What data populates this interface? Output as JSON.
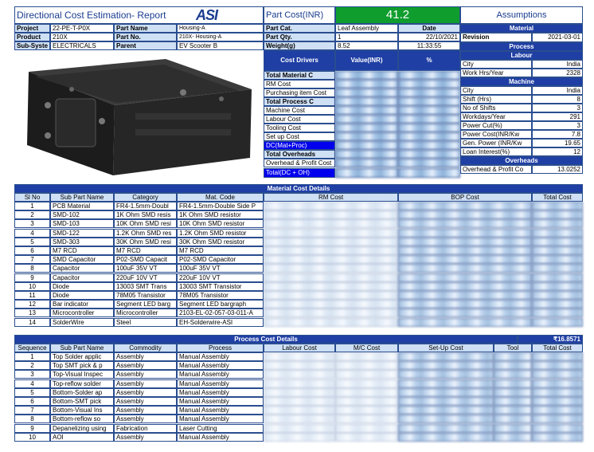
{
  "header": {
    "title": "Directional Cost Estimation- Report",
    "logo": "ASI",
    "part_cost_label": "Part Cost(INR)",
    "part_cost_value": "41.2",
    "assumptions_label": "Assumptions",
    "project_label": "Project",
    "project_value": "22-PE-T-P0X",
    "product_label": "Product",
    "product_value": "210X",
    "subsys_label": "Sub-Syste",
    "subsys_value": "ELECTRICALS",
    "part_name_label": "Part Name",
    "part_name_value": "Housing-A",
    "part_no_label": "Part No.",
    "part_no_value": "210X- Housing-A",
    "parent_label": "Parent",
    "parent_value": "EV Scooter B",
    "part_cat_label": "Part Cat.",
    "part_cat_value": "Leaf Assembly",
    "date_label": "Date",
    "date_value": "22/10/2021",
    "part_qty_label": "Part Qty.",
    "part_qty_value": "1",
    "weight_label": "Weight(g)",
    "weight_value": "8.52",
    "time_value": "11:33:55"
  },
  "drivers": {
    "col1": "Cost Drivers",
    "col2": "Value(INR)",
    "col3": "%",
    "rows": [
      "Total Material C",
      "RM Cost",
      "Purchasing item Cost",
      "Total Process C",
      "Machine Cost",
      "Labour Cost",
      "Tooling Cost",
      "Set up Cost",
      "DC(Mat+Proc)",
      "Total Overheads",
      "Overhead & Profit Cost",
      "Total(DC + OH)"
    ]
  },
  "assumptions": {
    "material_header": "Material",
    "revision_label": "Revision",
    "revision_value": "2021-03-01",
    "process_header": "Process",
    "labour_header": "Labour",
    "labour_rows": [
      [
        "City",
        "India"
      ],
      [
        "Work Hrs/Year",
        "2328"
      ]
    ],
    "machine_header": "Machine",
    "machine_rows": [
      [
        "City",
        "India"
      ],
      [
        "Shift (Hrs)",
        "8"
      ],
      [
        "No of Shifts",
        "3"
      ],
      [
        "Workdays/Year",
        "291"
      ],
      [
        "Power Cut(%)",
        "3"
      ],
      [
        "Power Cost(INR/Kw",
        "7.8"
      ],
      [
        "Gen. Power (INR/Kw",
        "19.65"
      ],
      [
        "Loan Interest(%)",
        "12"
      ]
    ],
    "overheads_header": "Overheads",
    "overhead_rows": [
      [
        "Overhead & Profit Co",
        "13.0252"
      ]
    ]
  },
  "material": {
    "title": "Material Cost Details",
    "headers": [
      "Sl No",
      "Sub Part Name",
      "Category",
      "Mat. Code",
      "RM Cost",
      "BOP Cost",
      "Total Cost"
    ],
    "rows": [
      [
        "1",
        "PCB Material",
        "FR4-1.5mm-Doubl",
        "FR4-1.5mm-Double Side P"
      ],
      [
        "2",
        "SMD-102",
        "1K Ohm SMD resis",
        "1K Ohm SMD resistor"
      ],
      [
        "3",
        "SMD-103",
        "10K Ohm SMD resi",
        "10K Ohm SMD resistor"
      ],
      [
        "4",
        "SMD-122",
        "1.2K Ohm SMD res",
        "1.2K Ohm SMD resistor"
      ],
      [
        "5",
        "SMD-303",
        "30K Ohm SMD resi",
        "30K Ohm SMD resistor"
      ],
      [
        "6",
        "M7 RCD",
        "M7 RCD",
        "M7 RCD"
      ],
      [
        "7",
        "SMD Capacitor",
        "P02-SMD Capacit",
        "P02-SMD Capacitor"
      ],
      [
        "8",
        "Capacitor",
        "100uF 35V VT",
        "100uF 35V VT"
      ],
      [
        "9",
        "Capacitor",
        "220uF 10V VT",
        "220uF 10V VT"
      ],
      [
        "10",
        "Diode",
        "13003 SMT Trans",
        "13003 SMT Transistor"
      ],
      [
        "11",
        "Diode",
        "78M05 Transistor",
        "78M05 Transistor"
      ],
      [
        "12",
        "Bar indicator",
        "Segment LED barg",
        "Segment LED bargraph"
      ],
      [
        "13",
        "Microcontroller",
        "Microcontroller",
        "2103-EL-02-057-03-011-A"
      ],
      [
        "14",
        "SolderWire",
        "Steel",
        "EH-Solderwire-ASI"
      ]
    ]
  },
  "process": {
    "title": "Process Cost Details",
    "total": "₹16.8571",
    "headers": [
      "Sequence",
      "Sub Part Name",
      "Commodity",
      "Process",
      "Labour Cost",
      "M/C Cost",
      "Set-Up Cost",
      "Tool",
      "Total Cost"
    ],
    "rows": [
      [
        "1",
        "Top Solder applic",
        "Assembly",
        "Manual Assembly"
      ],
      [
        "2",
        "Top SMT pick & p",
        "Assembly",
        "Manual Assembly"
      ],
      [
        "3",
        "Top-Visual Inspec",
        "Assembly",
        "Manual Assembly"
      ],
      [
        "4",
        "Top-reflow solder",
        "Assembly",
        "Manual Assembly"
      ],
      [
        "5",
        "Bottom-Solder ap",
        "Assembly",
        "Manual Assembly"
      ],
      [
        "6",
        "Bottom-SMT pick",
        "Assembly",
        "Manual Assembly"
      ],
      [
        "7",
        "Bottom-Visual Ins",
        "Assembly",
        "Manual Assembly"
      ],
      [
        "8",
        "Bottom-reflow so",
        "Assembly",
        "Manual Assembly"
      ],
      [
        "9",
        "Depanelizing using",
        "Fabrication",
        "Laser Cutting"
      ],
      [
        "10",
        "AOI",
        "Assembly",
        "Manual Assembly"
      ]
    ]
  }
}
